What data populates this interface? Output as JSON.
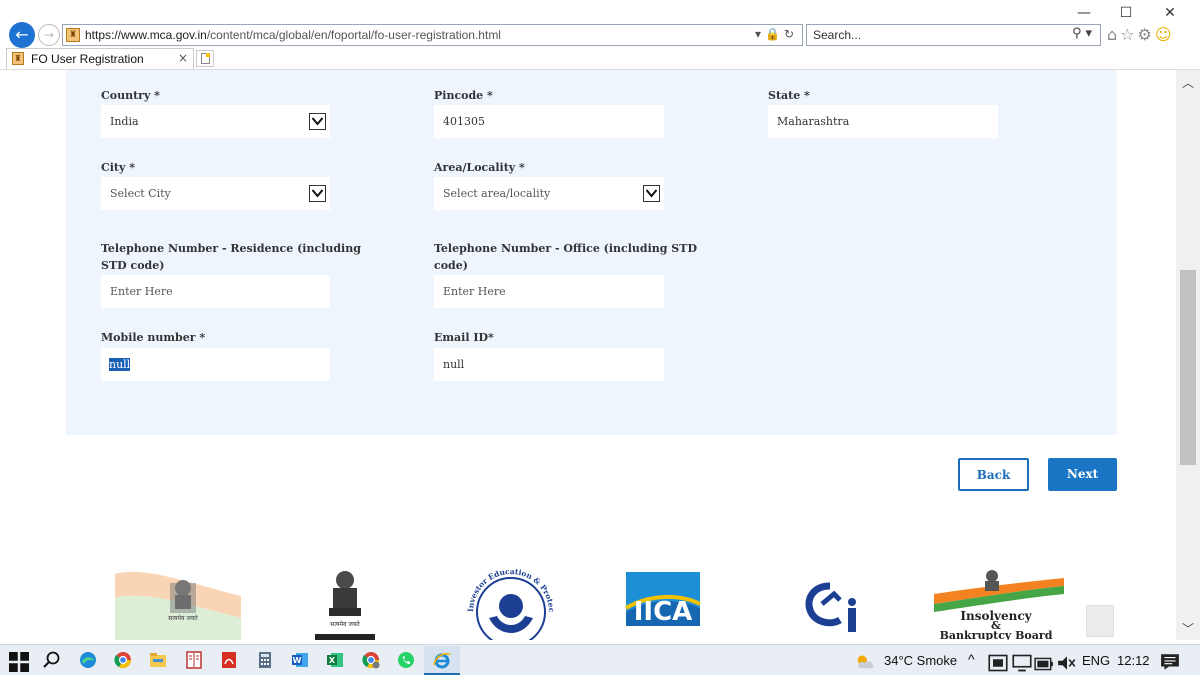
{
  "browser": {
    "url_prefix": "https://www.mca.gov.in",
    "url_rest": "/content/mca/global/en/foportal/fo-user-registration.html",
    "search_placeholder": "Search...",
    "tab_title": "FO User Registration",
    "tab_close": "×",
    "window_minimize": "—",
    "window_maximize": "☐",
    "window_close": "✕"
  },
  "form": {
    "country": {
      "label": "Country *",
      "value": "India"
    },
    "pincode": {
      "label": "Pincode *",
      "value": "401305"
    },
    "state": {
      "label": "State *",
      "value": "Maharashtra"
    },
    "city": {
      "label": "City *",
      "value": "Select City"
    },
    "area": {
      "label": "Area/Locality *",
      "value": "Select area/locality"
    },
    "tel_residence": {
      "label_line1": "Telephone Number - Residence (including",
      "label_line2": "STD code)",
      "placeholder": "Enter Here"
    },
    "tel_office": {
      "label_line1": "Telephone Number - Office (including STD",
      "label_line2": "code)",
      "placeholder": "Enter Here"
    },
    "mobile": {
      "label": "Mobile number *",
      "value": "null"
    },
    "email": {
      "label": "Email ID*",
      "value": "null"
    }
  },
  "buttons": {
    "back": "Back",
    "next": "Next"
  },
  "logos": {
    "emblem_caption": "सत्यमेव जयते",
    "iepfa_ring": "Investor Education & Protection Fund Authority",
    "iica": "IICA",
    "ibbi_line1": "Insolvency",
    "ibbi_line2": "&",
    "ibbi_line3": "Bankruptcy Board"
  },
  "taskbar": {
    "weather": "34°C Smoke",
    "language": "ENG",
    "time": "12:12"
  },
  "colors": {
    "accent": "#1a76c4",
    "panel": "#eef5fd",
    "back_circle": "#1e73d2"
  }
}
